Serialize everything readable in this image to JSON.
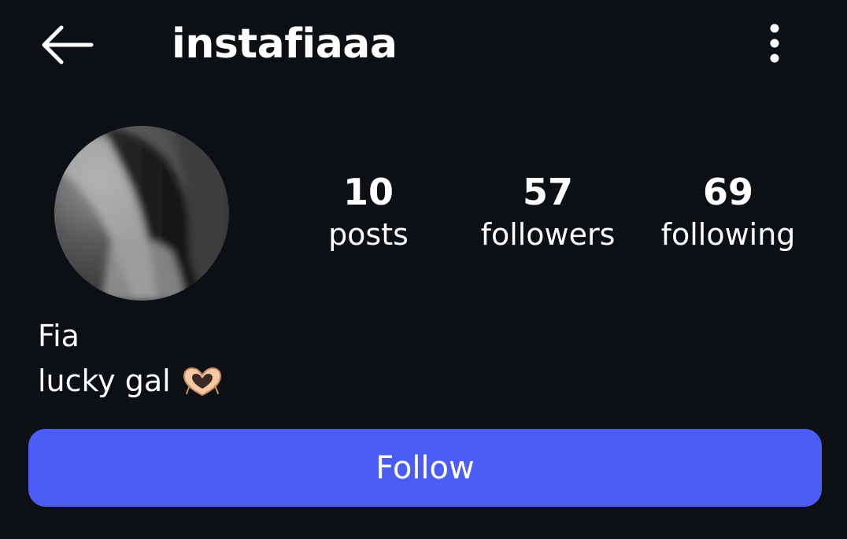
{
  "header": {
    "username": "instafiaaa",
    "back_icon": "arrow-left-icon",
    "menu_icon": "more-vertical-icon"
  },
  "profile": {
    "avatar_icon": "profile-photo",
    "display_name": "Fia",
    "bio_text": "lucky gal",
    "bio_emoji": "heart-hands-emoji"
  },
  "stats": {
    "posts": {
      "count": "10",
      "label": "posts"
    },
    "followers": {
      "count": "57",
      "label": "followers"
    },
    "following": {
      "count": "69",
      "label": "following"
    }
  },
  "actions": {
    "follow_label": "Follow"
  },
  "colors": {
    "background": "#0c0f14",
    "text": "#ffffff",
    "follow_button": "#4b5cf7"
  }
}
